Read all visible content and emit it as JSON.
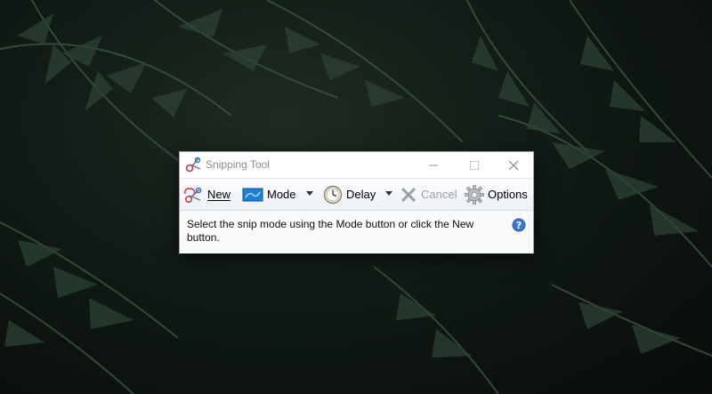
{
  "window": {
    "title": "Snipping Tool",
    "controls": {
      "minimize": "minimize",
      "maximize": "maximize",
      "close": "close"
    }
  },
  "toolbar": {
    "new_label": "New",
    "mode_label": "Mode",
    "delay_label": "Delay",
    "cancel_label": "Cancel",
    "options_label": "Options",
    "cancel_disabled": true
  },
  "message": {
    "text": "Select the snip mode using the Mode button or click the New button."
  },
  "icons": {
    "app": "scissors-icon",
    "new": "new-snip-scissors-icon",
    "mode": "mode-rectangle-icon",
    "delay": "clock-icon",
    "cancel": "cancel-x-icon",
    "options": "gear-icon",
    "help": "help-question-icon"
  },
  "colors": {
    "desktop_background": "#0d130f",
    "window_background": "#ffffff",
    "toolbar_gradient_top": "#fbfcfe",
    "toolbar_gradient_bottom": "#edf1f6",
    "title_text": "#8a8a8a",
    "disabled_text": "#a0a0a0",
    "help_icon": "#2d5fb3",
    "mode_icon": "#1e7fd6"
  }
}
